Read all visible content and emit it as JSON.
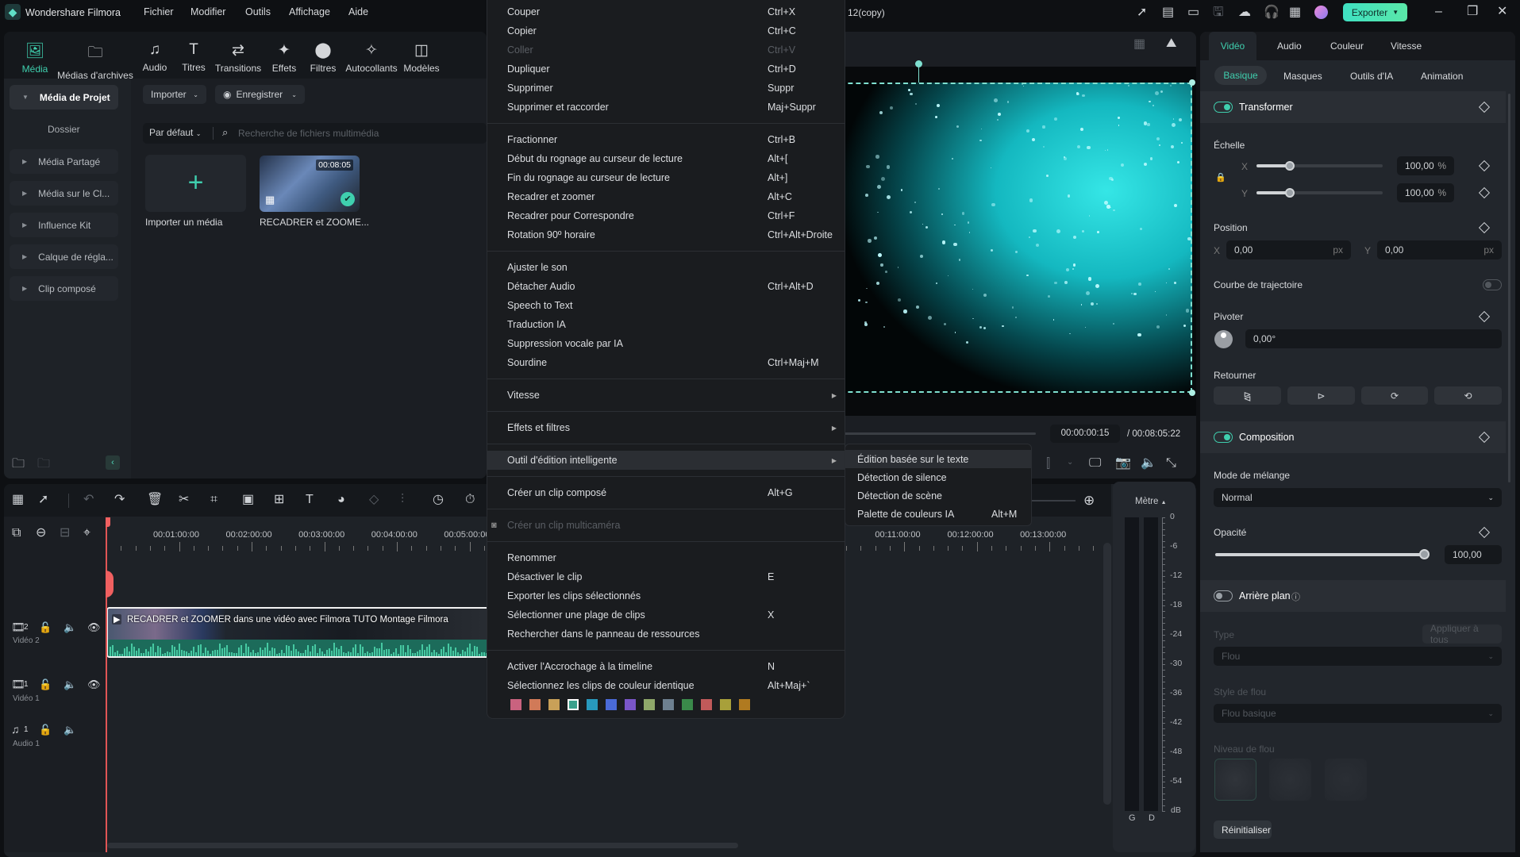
{
  "app": {
    "title": "Wondershare Filmora",
    "project_title": "12(copy)",
    "menu": [
      "Fichier",
      "Modifier",
      "Outils",
      "Affichage",
      "Aide"
    ],
    "export_label": "Exporter",
    "accent": "#3fcfae"
  },
  "toolbar": [
    {
      "label": "Média",
      "icon": "media-icon",
      "active": true
    },
    {
      "label": "Médias d'archives",
      "icon": "stock-media-icon"
    },
    {
      "label": "Audio",
      "icon": "music-note-icon"
    },
    {
      "label": "Titres",
      "icon": "title-icon"
    },
    {
      "label": "Transitions",
      "icon": "transitions-icon"
    },
    {
      "label": "Effets",
      "icon": "effects-icon"
    },
    {
      "label": "Filtres",
      "icon": "filters-icon"
    },
    {
      "label": "Autocollants",
      "icon": "stickers-icon"
    },
    {
      "label": "Modèles",
      "icon": "templates-icon"
    }
  ],
  "sidebar": {
    "items": [
      "Média de Projet",
      "Dossier",
      "Média Partagé",
      "Média sur le Cl...",
      "Influence Kit",
      "Calque de régla...",
      "Clip composé"
    ]
  },
  "media": {
    "import_btn": "Importer",
    "record_btn": "Enregistrer",
    "sort": "Par défaut",
    "search_placeholder": "Recherche de fichiers multimédia",
    "import_card": "Importer un média",
    "clip_name": "RECADRER et ZOOME...",
    "clip_duration": "00:08:05"
  },
  "preview": {
    "current_time": "00:00:00:15",
    "total_time": "/ 00:08:05:22"
  },
  "context_menu": [
    {
      "label": "Couper",
      "shortcut": "Ctrl+X"
    },
    {
      "label": "Copier",
      "shortcut": "Ctrl+C"
    },
    {
      "label": "Coller",
      "shortcut": "Ctrl+V",
      "disabled": true
    },
    {
      "label": "Dupliquer",
      "shortcut": "Ctrl+D"
    },
    {
      "label": "Supprimer",
      "shortcut": "Suppr"
    },
    {
      "label": "Supprimer et raccorder",
      "shortcut": "Maj+Suppr"
    },
    {
      "sep": true
    },
    {
      "label": "Fractionner",
      "shortcut": "Ctrl+B"
    },
    {
      "label": "Début du rognage au curseur de lecture",
      "shortcut": "Alt+["
    },
    {
      "label": "Fin du rognage au curseur de lecture",
      "shortcut": "Alt+]"
    },
    {
      "label": "Recadrer et zoomer",
      "shortcut": "Alt+C"
    },
    {
      "label": "Recadrer pour Correspondre",
      "shortcut": "Ctrl+F"
    },
    {
      "label": "Rotation 90º horaire",
      "shortcut": "Ctrl+Alt+Droite"
    },
    {
      "sep": true
    },
    {
      "label": "Ajuster le son"
    },
    {
      "label": "Détacher Audio",
      "shortcut": "Ctrl+Alt+D"
    },
    {
      "label": "Speech to Text"
    },
    {
      "label": "Traduction IA"
    },
    {
      "label": "Suppression vocale par IA"
    },
    {
      "label": "Sourdine",
      "shortcut": "Ctrl+Maj+M"
    },
    {
      "sep": true
    },
    {
      "label": "Vitesse",
      "submenu": true
    },
    {
      "sep": true
    },
    {
      "label": "Effets et filtres",
      "submenu": true
    },
    {
      "sep": true
    },
    {
      "label": "Outil d'édition intelligente",
      "submenu": true,
      "highlighted": true
    },
    {
      "sep": true
    },
    {
      "label": "Créer un clip composé",
      "shortcut": "Alt+G"
    },
    {
      "sep": true
    },
    {
      "label": "Créer un clip multicaméra",
      "disabled": true
    },
    {
      "sep": true
    },
    {
      "label": "Renommer"
    },
    {
      "label": "Désactiver le clip",
      "shortcut": "E"
    },
    {
      "label": "Exporter les clips sélectionnés"
    },
    {
      "label": "Sélectionner une plage de clips",
      "shortcut": "X"
    },
    {
      "label": "Rechercher dans le panneau de ressources"
    },
    {
      "sep": true
    },
    {
      "label": "Activer l'Accrochage à la timeline",
      "shortcut": "N"
    },
    {
      "label": "Sélectionnez les clips de couleur identique",
      "shortcut": "Alt+Maj+`"
    }
  ],
  "color_swatches": [
    "#c9627f",
    "#d17a58",
    "#c9a058",
    "#3aa08c",
    "#2899bd",
    "#4a6ad8",
    "#7a56c8",
    "#8fa86a",
    "#6e8090",
    "#3a8a4a",
    "#c05a5a",
    "#a8a03a",
    "#b07a20"
  ],
  "selected_swatch": 3,
  "submenu": [
    {
      "label": "Édition basée sur le texte",
      "highlighted": true
    },
    {
      "label": "Détection de silence"
    },
    {
      "label": "Détection de scène"
    },
    {
      "label": "Palette de couleurs IA",
      "shortcut": "Alt+M"
    }
  ],
  "timeline": {
    "ruler_left": [
      "00:01:00:00",
      "00:02:00:00",
      "00:03:00:00",
      "00:04:00:00",
      "00:05:00:00"
    ],
    "ruler_right": [
      "00:11:00:00",
      "00:12:00:00",
      "00:13:00:00"
    ],
    "clip_title": "RECADRER et ZOOMER dans une vidéo avec Filmora  TUTO Montage Filmora",
    "tracks": [
      {
        "num": "2",
        "label": "Vidéo 2"
      },
      {
        "num": "1",
        "label": "Vidéo 1"
      },
      {
        "num": "1",
        "label": "Audio 1"
      }
    ],
    "meter_label": "Mètre",
    "meter_scale": [
      "0",
      "-6",
      "-12",
      "-18",
      "-24",
      "-30",
      "-36",
      "-42",
      "-48",
      "-54",
      "dB"
    ],
    "meter_channels": [
      "G",
      "D"
    ]
  },
  "properties": {
    "tabs": [
      "Vidéo",
      "Audio",
      "Couleur",
      "Vitesse"
    ],
    "subtabs": [
      "Basique",
      "Masques",
      "Outils d'IA",
      "Animation"
    ],
    "transform": "Transformer",
    "scale": "Échelle",
    "scale_x": "100,00",
    "scale_y": "100,00",
    "scale_level": 0.25,
    "percent": "%",
    "x": "X",
    "y": "Y",
    "position": "Position",
    "pos_x": "0,00",
    "pos_y": "0,00",
    "px": "px",
    "trajectory": "Courbe de trajectoire",
    "rotate": "Pivoter",
    "rotate_val": "0,00°",
    "flip": "Retourner",
    "composition": "Composition",
    "blend_mode": "Mode de mélange",
    "blend_val": "Normal",
    "opacity": "Opacité",
    "opacity_val": "100,00",
    "opacity_level": 1.0,
    "background": "Arrière plan",
    "type": "Type",
    "apply_all": "Appliquer à tous",
    "type_val": "Flou",
    "blur_style": "Style de flou",
    "blur_style_val": "Flou basique",
    "blur_level": "Niveau de flou",
    "reset": "Réinitialiser"
  }
}
